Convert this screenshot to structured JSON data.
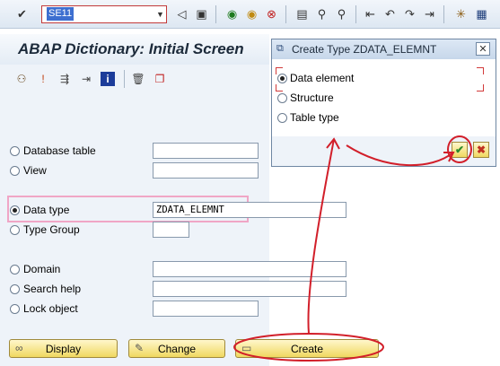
{
  "toolbar": {
    "command_field_value": "SE11",
    "icons": [
      "enter-icon",
      "save-icon",
      "back-icon",
      "exit-icon",
      "cancel-icon",
      "print-icon",
      "find-icon",
      "find-next-icon",
      "first-page-icon",
      "previous-page-icon",
      "next-page-icon",
      "last-page-icon",
      "create-session-icon",
      "help-icon"
    ]
  },
  "page": {
    "title": "ABAP Dictionary: Initial Screen"
  },
  "app_toolbar": {
    "icons": [
      "other-object-icon",
      "where-used-icon",
      "display-object-list-icon",
      "display-log-icon",
      "information-icon",
      "delete-icon",
      "copy-icon"
    ]
  },
  "objects": [
    {
      "label": "Database table",
      "selected": false,
      "value": ""
    },
    {
      "label": "View",
      "selected": false,
      "value": ""
    },
    {
      "label": "Data type",
      "selected": true,
      "value": "ZDATA_ELEMNT"
    },
    {
      "label": "Type Group",
      "selected": false,
      "value": ""
    },
    {
      "label": "Domain",
      "selected": false,
      "value": ""
    },
    {
      "label": "Search help",
      "selected": false,
      "value": ""
    },
    {
      "label": "Lock object",
      "selected": false,
      "value": ""
    }
  ],
  "buttons": {
    "display": "Display",
    "change": "Change",
    "create": "Create"
  },
  "dialog": {
    "title": "Create Type ZDATA_ELEMNT",
    "close_symbol": "✕",
    "options": [
      {
        "label": "Data element",
        "selected": true
      },
      {
        "label": "Structure",
        "selected": false
      },
      {
        "label": "Table type",
        "selected": false
      }
    ]
  },
  "colors": {
    "annotation_red": "#d21f2a",
    "highlight_pink": "#f0a6c6",
    "button_yellow": "#f0d860"
  }
}
